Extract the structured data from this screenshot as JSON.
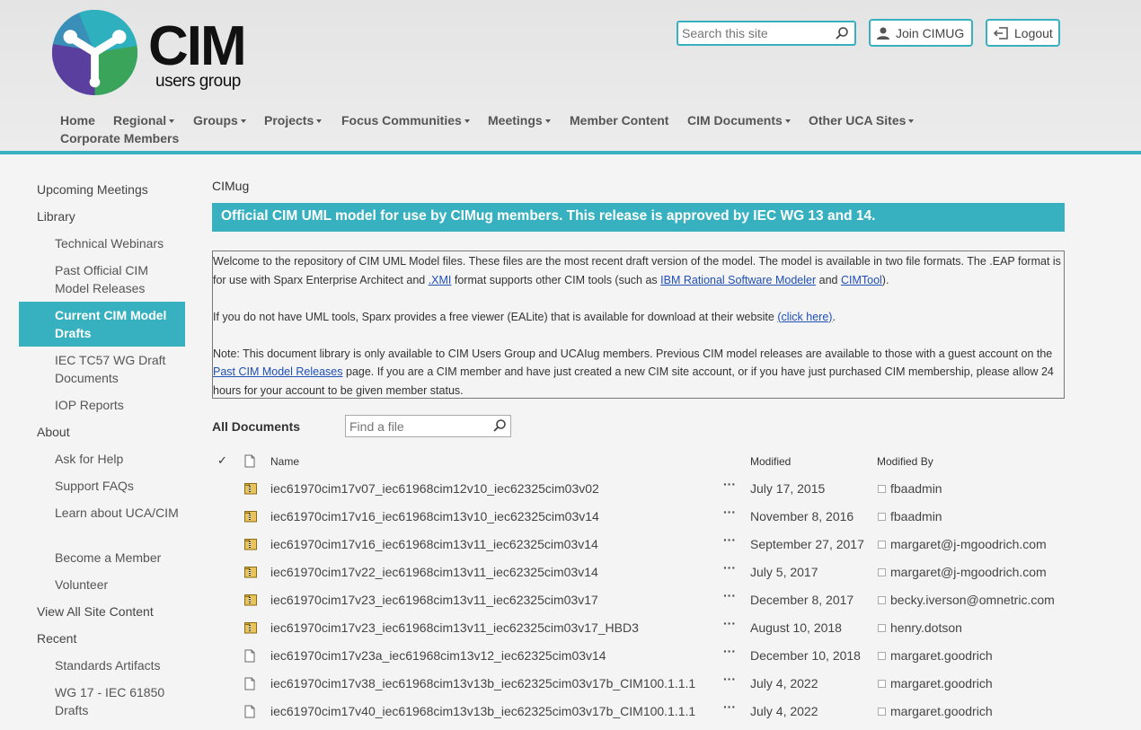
{
  "brand": {
    "name": "CIM",
    "tagline": "users group"
  },
  "header": {
    "search_placeholder": "Search this site",
    "join_label": "Join CIMUG",
    "logout_label": "Logout"
  },
  "nav": [
    {
      "label": "Home",
      "dropdown": false
    },
    {
      "label": "Regional",
      "dropdown": true
    },
    {
      "label": "Groups",
      "dropdown": true
    },
    {
      "label": "Projects",
      "dropdown": true
    },
    {
      "label": "Focus Communities",
      "dropdown": true
    },
    {
      "label": "Meetings",
      "dropdown": true
    },
    {
      "label": "Member Content",
      "dropdown": false
    },
    {
      "label": "CIM Documents",
      "dropdown": true
    },
    {
      "label": "Other UCA Sites",
      "dropdown": true
    },
    {
      "label": "Corporate Members",
      "dropdown": false
    }
  ],
  "sidebar": [
    {
      "label": "Upcoming Meetings"
    },
    {
      "label": "Library"
    },
    {
      "label": "Technical Webinars"
    },
    {
      "label": "Past Official CIM Model Releases"
    },
    {
      "label": "Current CIM Model Drafts"
    },
    {
      "label": "IEC TC57 WG Draft Documents"
    },
    {
      "label": "IOP Reports"
    },
    {
      "label": "About"
    },
    {
      "label": "Ask for Help"
    },
    {
      "label": "Support FAQs"
    },
    {
      "label": "Learn about UCA/CIM"
    },
    {
      "label": "Become a Member"
    },
    {
      "label": "Volunteer"
    },
    {
      "label": "View All Site Content"
    },
    {
      "label": "Recent"
    },
    {
      "label": "Standards Artifacts"
    },
    {
      "label": "WG 17 - IEC 61850 Drafts"
    }
  ],
  "main": {
    "breadcrumb": "CIMug",
    "banner": "Official CIM UML model for use by CIMug members. This release is approved by IEC WG 13 and 14.",
    "intro": {
      "p1_a": "Welcome to the repository of CIM UML Model files. These files are the most recent draft version of the model. The model is available in two file formats. The .EAP format is for use with Sparx Enterprise Architect and ",
      "p1_link1": ".XMI",
      "p1_b": " format supports other CIM tools (such as ",
      "p1_link2": "IBM Rational Software Modeler",
      "p1_c": " and ",
      "p1_link3": "CIMTool",
      "p1_d": ").",
      "p2_a": "If you do not have UML tools, Sparx provides a free viewer (EALite) that is available for download at their website ",
      "p2_link": "(click here)",
      "p2_b": ".",
      "p3_a": "Note:  This document library is only available to CIM Users Group and UCAIug members.  Previous CIM model releases are available to those with a guest account on the ",
      "p3_link": "Past CIM Model Releases",
      "p3_b": " page.  If you are a CIM member and have just created a new CIM site account, or if you have just purchased CIM membership, please allow 24 hours for your account to be given member status."
    },
    "library": {
      "view_label": "All Documents",
      "find_placeholder": "Find a file",
      "columns": {
        "name": "Name",
        "modified": "Modified",
        "modified_by": "Modified By"
      },
      "rows": [
        {
          "icon": "zip-icon",
          "name": "iec61970cim17v07_iec61968cim12v10_iec62325cim03v02",
          "modified": "July 17, 2015",
          "modified_by": "fbaadmin"
        },
        {
          "icon": "zip-icon",
          "name": "iec61970cim17v16_iec61968cim13v10_iec62325cim03v14",
          "modified": "November 8, 2016",
          "modified_by": "fbaadmin"
        },
        {
          "icon": "zip-icon",
          "name": "iec61970cim17v16_iec61968cim13v11_iec62325cim03v14",
          "modified": "September 27, 2017",
          "modified_by": "margaret@j-mgoodrich.com"
        },
        {
          "icon": "zip-icon",
          "name": "iec61970cim17v22_iec61968cim13v11_iec62325cim03v14",
          "modified": "July 5, 2017",
          "modified_by": "margaret@j-mgoodrich.com"
        },
        {
          "icon": "zip-icon",
          "name": "iec61970cim17v23_iec61968cim13v11_iec62325cim03v17",
          "modified": "December 8, 2017",
          "modified_by": "becky.iverson@omnetric.com"
        },
        {
          "icon": "zip-icon",
          "name": "iec61970cim17v23_iec61968cim13v11_iec62325cim03v17_HBD3",
          "modified": "August 10, 2018",
          "modified_by": "henry.dotson"
        },
        {
          "icon": "file-icon",
          "name": "iec61970cim17v23a_iec61968cim13v12_iec62325cim03v14",
          "modified": "December 10, 2018",
          "modified_by": "margaret.goodrich"
        },
        {
          "icon": "file-icon",
          "name": "iec61970cim17v38_iec61968cim13v13b_iec62325cim03v17b_CIM100.1.1.1",
          "modified": "July 4, 2022",
          "modified_by": "margaret.goodrich"
        },
        {
          "icon": "file-icon",
          "name": "iec61970cim17v40_iec61968cim13v13b_iec62325cim03v17b_CIM100.1.1.1",
          "modified": "July 4, 2022",
          "modified_by": "margaret.goodrich"
        }
      ]
    }
  },
  "colors": {
    "accent": "#37b1bf",
    "link": "#1f4fb5"
  }
}
